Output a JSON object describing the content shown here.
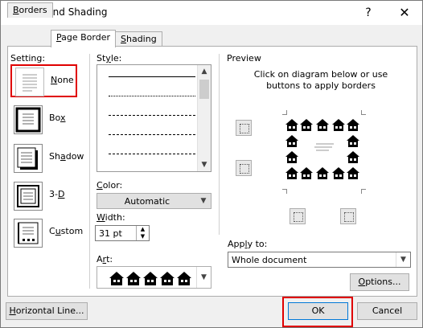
{
  "window": {
    "title": "Borders and Shading",
    "help_glyph": "?",
    "close_glyph": "✕"
  },
  "tabs": [
    {
      "label": "Borders",
      "accel": "B",
      "rest": "orders",
      "active": false
    },
    {
      "label": "Page Border",
      "accel": "P",
      "rest": "age Border",
      "active": true
    },
    {
      "label": "Shading",
      "accel": "S",
      "rest": "hading",
      "active": false
    }
  ],
  "setting": {
    "label": "Setting:",
    "items": [
      {
        "label": "None",
        "accel": "N",
        "rest": "one",
        "icon": "setting-none-icon",
        "selected": true
      },
      {
        "label": "Box",
        "accel": "x",
        "pre": "Bo",
        "icon": "setting-box-icon",
        "selected": false
      },
      {
        "label": "Shadow",
        "accel": "a",
        "pre": "Sh",
        "rest": "dow",
        "icon": "setting-shadow-icon",
        "selected": false
      },
      {
        "label": "3-D",
        "accel": "D",
        "pre": "3-",
        "icon": "setting-3d-icon",
        "selected": false
      },
      {
        "label": "Custom",
        "accel": "u",
        "pre": "C",
        "rest": "stom",
        "icon": "setting-custom-icon",
        "selected": false
      }
    ]
  },
  "style": {
    "label": "Style:",
    "accel": "y",
    "pre": "St",
    "rest": "le:"
  },
  "color": {
    "label": "Color:",
    "accel": "C",
    "rest": "olor:",
    "value": "Automatic"
  },
  "width": {
    "label": "Width:",
    "accel": "W",
    "rest": "idth:",
    "value": "31 pt"
  },
  "art": {
    "label": "Art:",
    "accel": "r",
    "pre": "A",
    "rest": "t:",
    "icon": "house-icon"
  },
  "preview": {
    "label": "Preview",
    "hint": "Click on diagram below or use buttons to apply borders"
  },
  "apply_to": {
    "label": "Apply to:",
    "accel": "l",
    "pre": "App",
    "rest": "y to:",
    "value": "Whole document"
  },
  "buttons": {
    "options": "Options...",
    "options_accel": "O",
    "options_rest": "ptions...",
    "horizontal_line": "Horizontal Line...",
    "hl_accel": "H",
    "hl_rest": "orizontal Line...",
    "ok": "OK",
    "cancel": "Cancel"
  },
  "colors": {
    "highlight_red": "#e00000",
    "window_bg": "#f0f0f0",
    "panel_bg": "#ffffff"
  }
}
